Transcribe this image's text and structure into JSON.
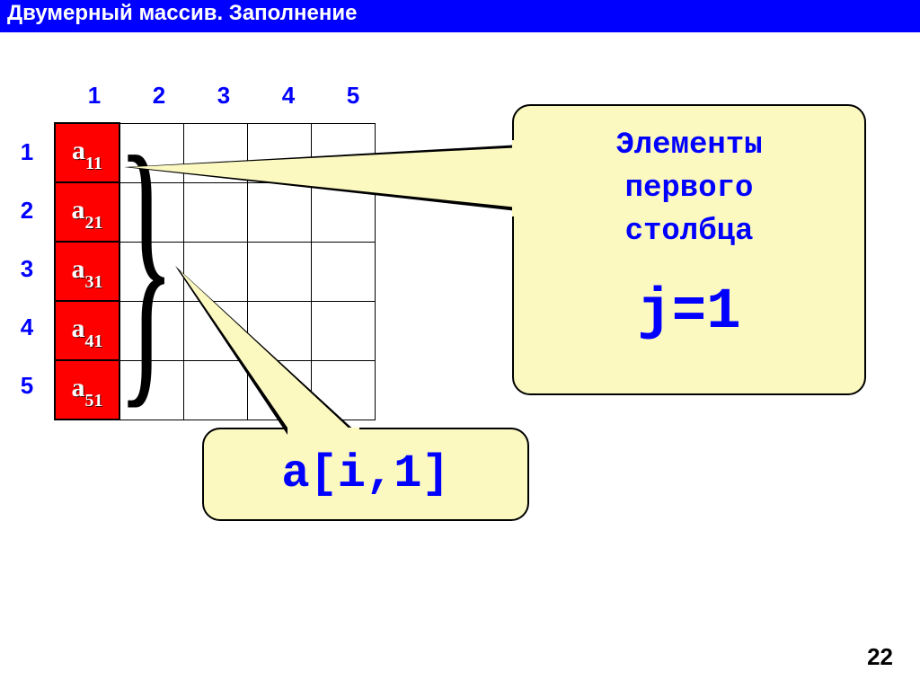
{
  "title": "Двумерный массив. Заполнение",
  "col_headers": [
    "1",
    "2",
    "3",
    "4",
    "5"
  ],
  "row_headers": [
    "1",
    "2",
    "3",
    "4",
    "5"
  ],
  "cells": {
    "c11": {
      "base": "a",
      "sub": "11"
    },
    "c21": {
      "base": "a",
      "sub": "21"
    },
    "c31": {
      "base": "a",
      "sub": "31"
    },
    "c41": {
      "base": "a",
      "sub": "41"
    },
    "c51": {
      "base": "a",
      "sub": "51"
    }
  },
  "callout_big": {
    "line1": "Элементы",
    "line2": "первого",
    "line3": "столбца",
    "formula": "j=1"
  },
  "callout_small": "a[i,1]",
  "page_number": "22",
  "colors": {
    "title_bg": "#0000ff",
    "highlight_bg": "#ff0000",
    "callout_bg": "#fbf8c0",
    "text_accent": "#0000ff"
  }
}
